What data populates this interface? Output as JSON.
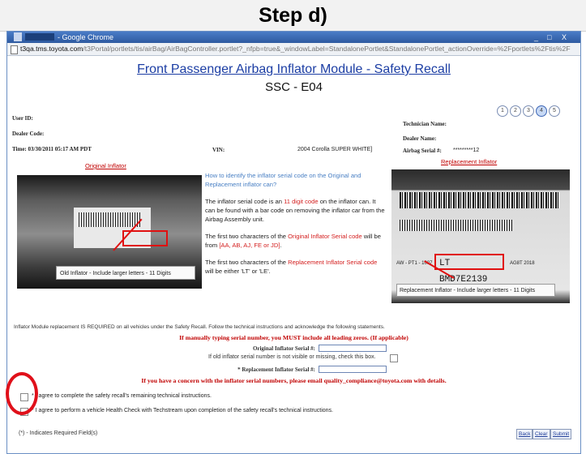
{
  "header": {
    "step_label": "Step d)"
  },
  "browser": {
    "tab_label": "T1",
    "title": "- Google Chrome",
    "window_controls": {
      "minimize": "_",
      "maximize": "□",
      "close": "X"
    },
    "url_host": "t3qa.tms.toyota.com",
    "url_rest": "/t3Portal/portlets/tis/airBag/AirBagController.portlet?_nfpb=true&_windowLabel=StandalonePortlet&StandalonePortlet_actionOverride=%2Fportlets%2Ftis%2F"
  },
  "page": {
    "title": "Front Passenger Airbag Inflator Module - Safety Recall",
    "subtitle": "SSC - E04",
    "user_id_label": "User ID:",
    "dealer_code_label": "Dealer Code:",
    "time_label": "Time: 03/30/2011 05:17 AM PDT",
    "vin_label": "VIN:",
    "vin_value": "2004 Corolla SUPER WHITE]",
    "technician_name_label": "Technician Name:",
    "dealer_name_label": "Dealer Name:",
    "airbag_serial_label": "Airbag Serial #:",
    "airbag_serial_value": "*********12",
    "steps": [
      "1",
      "2",
      "3",
      "4",
      "5"
    ],
    "active_step": "4",
    "original_inflator_link": "Original Inflator",
    "replacement_inflator_link": "Replacement Inflator",
    "old_inflator_caption": "Old Inflator - Include larger letters - 11 Digits",
    "replacement_caption": "Replacement Inflator - Include larger letters - 11 Digits",
    "lt_code": "LT  BMD7E2139",
    "right_small_code": "AW - PT1 - 1007",
    "right_small_code2": "AG8T 2018",
    "info": {
      "heading": "How to identify the inflator serial code on the Original and Replacement inflator can?",
      "p1_a": "The inflator serial code is an ",
      "p1_highlight": "11 digit code",
      "p1_b": " on the inflator can. It can be found with a bar code on removing the inflator car from the Airbag Assembly unit.",
      "p2_a": "The first two characters of the ",
      "p2_highlight": "Original Inflator Serial code",
      "p2_b": " will be from ",
      "p2_codes": "[AA, AB, AJ, FE or JD]",
      "p2_c": ".",
      "p3_a": "The first two characters of the ",
      "p3_highlight": "Replacement Inflator Serial code",
      "p3_b": " will be either 'LT' or 'LE'."
    },
    "instruction": "Inflator Module replacement IS REQUIRED on all vehicles under the Safety Recall. Follow the technical instructions and acknowledge the following statements.",
    "warning_zeros": "If manually typing serial number, you MUST include all leading zeros. (If applicable)",
    "original_serial_label": "Original Inflator Serial #:",
    "missing_note": "If old inflator serial number is not visible or missing, check this box.",
    "replacement_serial_label": "* Replacement Inflator Serial #:",
    "concern_warning": "If you have a concern with the inflator serial numbers, please email quality_compliance@toyota.com with details.",
    "agree1": "* I agree to complete the safety recall's remaining technical instructions.",
    "agree2": "* I agree to perform a vehicle Health Check with Techstream upon completion of the safety recall's technical instructions.",
    "required_note": "(*) - Indicates Required Field(s)",
    "buttons": {
      "back": "Back",
      "clear": "Clear",
      "submit": "Submit"
    }
  }
}
